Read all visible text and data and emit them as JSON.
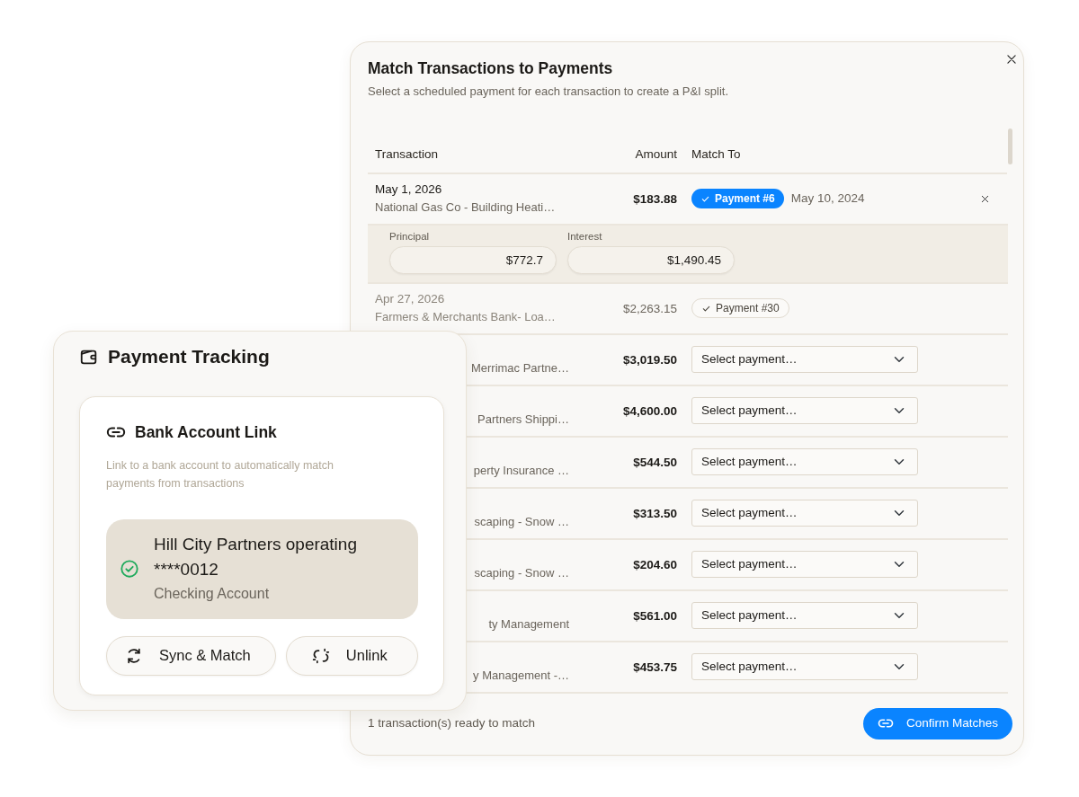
{
  "dialog": {
    "title": "Match Transactions to Payments",
    "subtitle": "Select a scheduled payment for each transaction to create a P&I split.",
    "columns": [
      "Transaction",
      "Amount",
      "Match To"
    ],
    "rows": [
      {
        "kind": "matched",
        "date": "May 1, 2026",
        "description": "National Gas Co - Building Heati…",
        "amount": "$183.88",
        "confirmed": true,
        "payment": "Payment #6",
        "payment_date": "May 10, 2024",
        "covered": false,
        "split": {
          "principal_label": "Principal",
          "principal": "$772.7",
          "interest_label": "Interest",
          "interest": "$1,490.45"
        }
      },
      {
        "kind": "matched",
        "date": "Apr 27, 2026",
        "description": "Farmers & Merchants Bank- Loa…",
        "amount": "$2,263.15",
        "confirmed": false,
        "payment": "Payment #30",
        "covered": false
      },
      {
        "kind": "unmatched",
        "description": "Merrimac Partne…",
        "amount": "$3,019.50",
        "placeholder": "Select payment…",
        "covered": true
      },
      {
        "kind": "unmatched",
        "description": "Partners Shippi…",
        "amount": "$4,600.00",
        "placeholder": "Select payment…",
        "covered": true
      },
      {
        "kind": "unmatched",
        "description": "perty Insurance …",
        "amount": "$544.50",
        "placeholder": "Select payment…",
        "covered": true
      },
      {
        "kind": "unmatched",
        "description": "scaping - Snow …",
        "amount": "$313.50",
        "placeholder": "Select payment…",
        "covered": true
      },
      {
        "kind": "unmatched",
        "description": "scaping - Snow …",
        "amount": "$204.60",
        "placeholder": "Select payment…",
        "covered": true
      },
      {
        "kind": "unmatched",
        "description": "ty Management",
        "amount": "$561.00",
        "placeholder": "Select payment…",
        "covered": true
      },
      {
        "kind": "unmatched",
        "description": "y Management -…",
        "amount": "$453.75",
        "placeholder": "Select payment…",
        "covered": true
      }
    ],
    "footer_text": "1 transaction(s) ready to match",
    "confirm_button": "Confirm Matches"
  },
  "tracking": {
    "title": "Payment Tracking",
    "section_title": "Bank Account Link",
    "description": "Link to a bank account to automatically match payments from transactions",
    "account": {
      "name": "Hill City Partners operating",
      "number": "****0012",
      "type": "Checking Account",
      "linked": true
    },
    "buttons": [
      {
        "kind": "sync",
        "label": "Sync & Match"
      },
      {
        "kind": "unlink",
        "label": "Unlink"
      }
    ]
  }
}
